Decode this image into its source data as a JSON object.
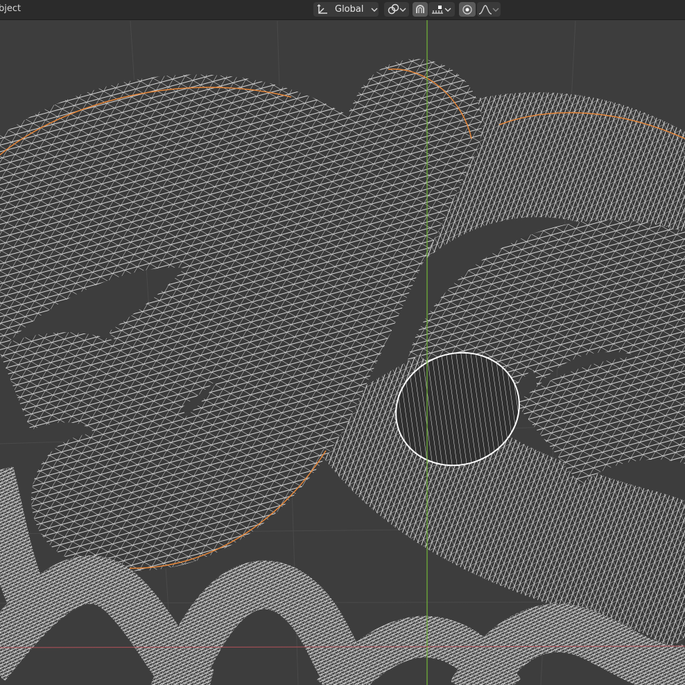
{
  "header": {
    "mode_label": "bject",
    "orientation": {
      "icon": "transform-orientation-icon",
      "value": "Global"
    },
    "pivot": {
      "icon": "pivot-point-icon"
    },
    "snap_toggle": {
      "icon": "snap-magnet-icon",
      "active": true
    },
    "snap_target": {
      "icon": "snap-increment-icon"
    },
    "proportional_toggle": {
      "icon": "proportional-editing-icon",
      "active": true
    },
    "falloff": {
      "icon": "falloff-curve-icon"
    }
  },
  "viewport": {
    "background": "#3d3d3d",
    "wire_color": "#ffffff",
    "selection_outline": "#e8883a",
    "axis_y_color": "#6fae3a",
    "axis_x_color": "#b5525a"
  }
}
